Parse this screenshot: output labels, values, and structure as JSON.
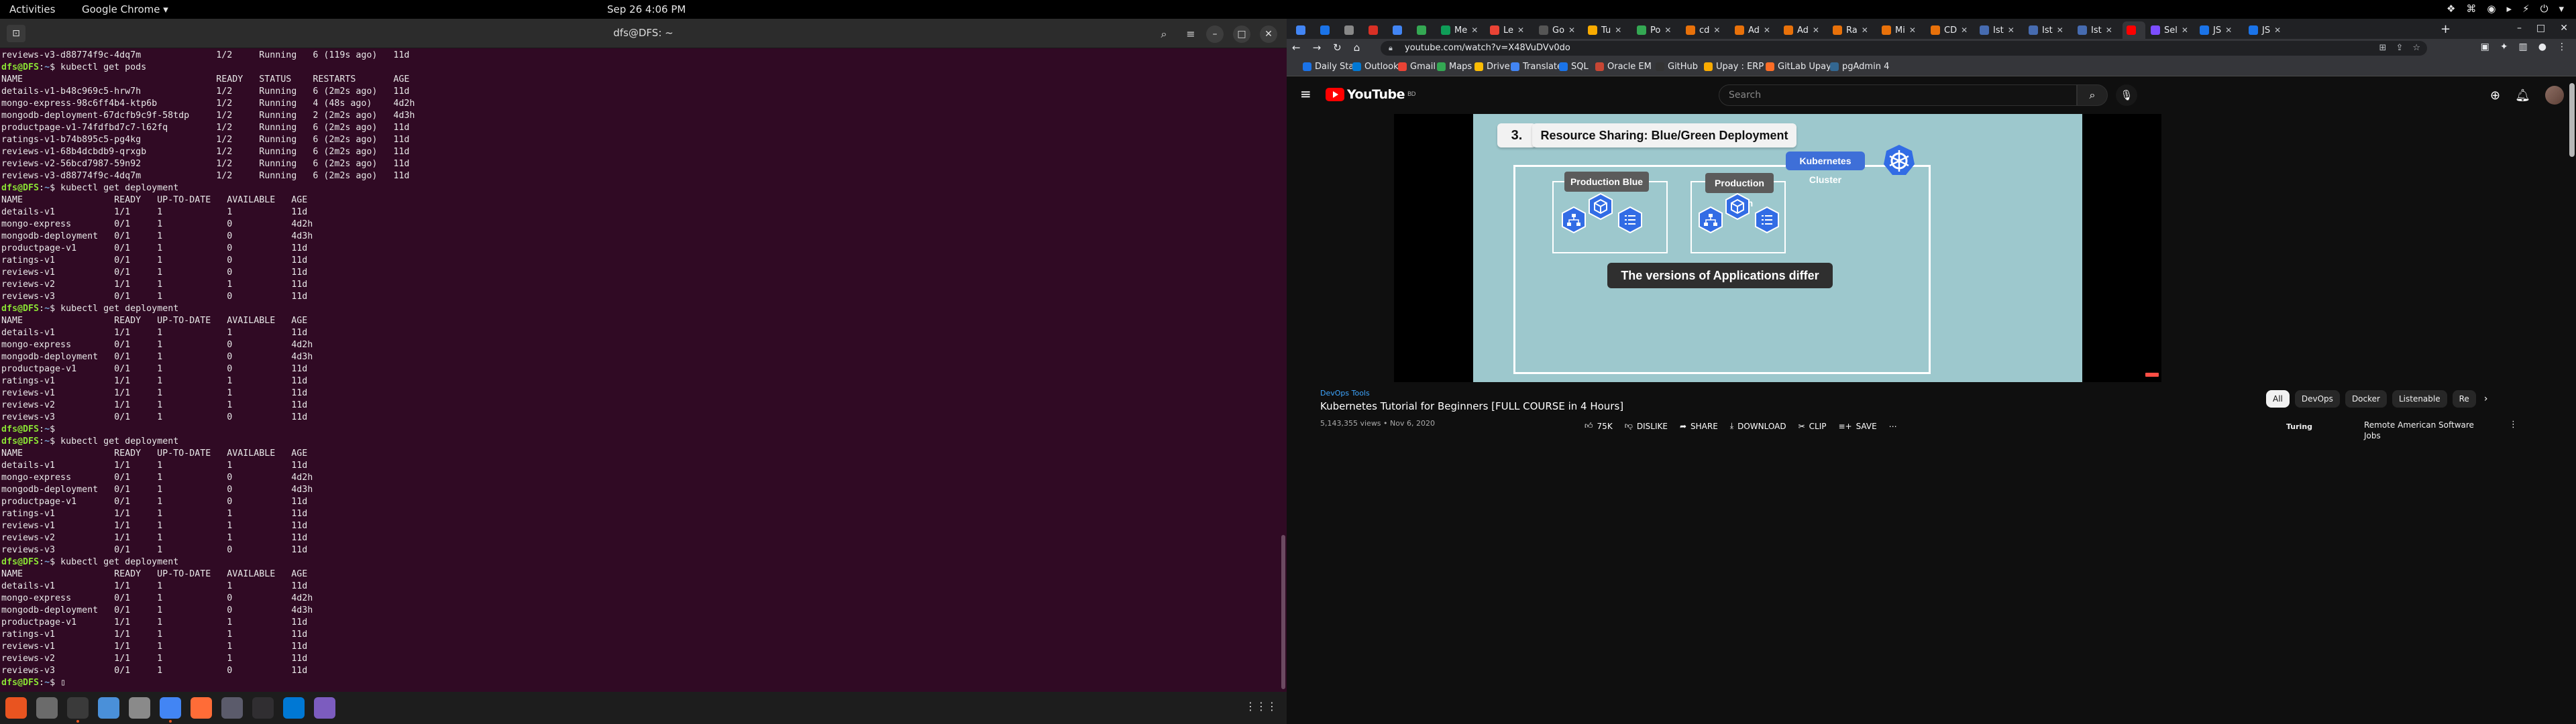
{
  "topbar": {
    "activities": "Activities",
    "app_menu": "Google Chrome ▾",
    "clock": "Sep 26  4:06 PM",
    "tray": [
      "❖",
      "⌘",
      "◉",
      "▸",
      "⚡",
      "⏻",
      "▾"
    ]
  },
  "terminal": {
    "title": "dfs@DFS: ~",
    "prompt": "dfs@DFS",
    "path": "~",
    "lines": [
      {
        "t": "out",
        "s": "reviews-v3-d88774f9c-4dq7m              1/2     Running   6 (119s ago)   11d"
      },
      {
        "t": "cmd",
        "s": "kubectl get pods"
      },
      {
        "t": "out",
        "s": "NAME                                    READY   STATUS    RESTARTS       AGE"
      },
      {
        "t": "out",
        "s": "details-v1-b48c969c5-hrw7h              1/2     Running   6 (2m2s ago)   11d"
      },
      {
        "t": "out",
        "s": "mongo-express-98c6ff4b4-ktp6b           1/2     Running   4 (48s ago)    4d2h"
      },
      {
        "t": "out",
        "s": "mongodb-deployment-67dcfb9c9f-58tdp     1/2     Running   2 (2m2s ago)   4d3h"
      },
      {
        "t": "out",
        "s": "productpage-v1-74fdfbd7c7-l62fq         1/2     Running   6 (2m2s ago)   11d"
      },
      {
        "t": "out",
        "s": "ratings-v1-b74b895c5-pg4kg              1/2     Running   6 (2m2s ago)   11d"
      },
      {
        "t": "out",
        "s": "reviews-v1-68b4dcbdb9-qrxgb             1/2     Running   6 (2m2s ago)   11d"
      },
      {
        "t": "out",
        "s": "reviews-v2-56bcd7987-59n92              1/2     Running   6 (2m2s ago)   11d"
      },
      {
        "t": "out",
        "s": "reviews-v3-d88774f9c-4dq7m              1/2     Running   6 (2m2s ago)   11d"
      },
      {
        "t": "cmd",
        "s": "kubectl get deployment"
      },
      {
        "t": "out",
        "s": "NAME                 READY   UP-TO-DATE   AVAILABLE   AGE"
      },
      {
        "t": "out",
        "s": "details-v1           1/1     1            1           11d"
      },
      {
        "t": "out",
        "s": "mongo-express        0/1     1            0           4d2h"
      },
      {
        "t": "out",
        "s": "mongodb-deployment   0/1     1            0           4d3h"
      },
      {
        "t": "out",
        "s": "productpage-v1       0/1     1            0           11d"
      },
      {
        "t": "out",
        "s": "ratings-v1           0/1     1            0           11d"
      },
      {
        "t": "out",
        "s": "reviews-v1           0/1     1            0           11d"
      },
      {
        "t": "out",
        "s": "reviews-v2           1/1     1            1           11d"
      },
      {
        "t": "out",
        "s": "reviews-v3           0/1     1            0           11d"
      },
      {
        "t": "cmd",
        "s": "kubectl get deployment"
      },
      {
        "t": "out",
        "s": "NAME                 READY   UP-TO-DATE   AVAILABLE   AGE"
      },
      {
        "t": "out",
        "s": "details-v1           1/1     1            1           11d"
      },
      {
        "t": "out",
        "s": "mongo-express        0/1     1            0           4d2h"
      },
      {
        "t": "out",
        "s": "mongodb-deployment   0/1     1            0           4d3h"
      },
      {
        "t": "out",
        "s": "productpage-v1       0/1     1            0           11d"
      },
      {
        "t": "out",
        "s": "ratings-v1           1/1     1            1           11d"
      },
      {
        "t": "out",
        "s": "reviews-v1           1/1     1            1           11d"
      },
      {
        "t": "out",
        "s": "reviews-v2           1/1     1            1           11d"
      },
      {
        "t": "out",
        "s": "reviews-v3           0/1     1            0           11d"
      },
      {
        "t": "cmd",
        "s": ""
      },
      {
        "t": "cmd",
        "s": "kubectl get deployment"
      },
      {
        "t": "out",
        "s": "NAME                 READY   UP-TO-DATE   AVAILABLE   AGE"
      },
      {
        "t": "out",
        "s": "details-v1           1/1     1            1           11d"
      },
      {
        "t": "out",
        "s": "mongo-express        0/1     1            0           4d2h"
      },
      {
        "t": "out",
        "s": "mongodb-deployment   0/1     1            0           4d3h"
      },
      {
        "t": "out",
        "s": "productpage-v1       0/1     1            0           11d"
      },
      {
        "t": "out",
        "s": "ratings-v1           1/1     1            1           11d"
      },
      {
        "t": "out",
        "s": "reviews-v1           1/1     1            1           11d"
      },
      {
        "t": "out",
        "s": "reviews-v2           1/1     1            1           11d"
      },
      {
        "t": "out",
        "s": "reviews-v3           0/1     1            0           11d"
      },
      {
        "t": "cmd",
        "s": "kubectl get deployment"
      },
      {
        "t": "out",
        "s": "NAME                 READY   UP-TO-DATE   AVAILABLE   AGE"
      },
      {
        "t": "out",
        "s": "details-v1           1/1     1            1           11d"
      },
      {
        "t": "out",
        "s": "mongo-express        0/1     1            0           4d2h"
      },
      {
        "t": "out",
        "s": "mongodb-deployment   0/1     1            0           4d3h"
      },
      {
        "t": "out",
        "s": "productpage-v1       1/1     1            1           11d"
      },
      {
        "t": "out",
        "s": "ratings-v1           1/1     1            1           11d"
      },
      {
        "t": "out",
        "s": "reviews-v1           1/1     1            1           11d"
      },
      {
        "t": "out",
        "s": "reviews-v2           1/1     1            1           11d"
      },
      {
        "t": "out",
        "s": "reviews-v3           0/1     1            0           11d"
      },
      {
        "t": "cmd",
        "s": "▯"
      }
    ]
  },
  "dock": {
    "apps": [
      {
        "name": "ubuntu-software-icon",
        "color": "#e95420"
      },
      {
        "name": "settings-icon",
        "color": "#6b6b6b"
      },
      {
        "name": "terminal-icon",
        "color": "#3a3a3a",
        "running": true
      },
      {
        "name": "text-editor-icon",
        "color": "#4a90d9"
      },
      {
        "name": "files-icon",
        "color": "#8a8a8a"
      },
      {
        "name": "chrome-icon",
        "color": "#4285f4",
        "running": true
      },
      {
        "name": "postman-icon",
        "color": "#ff6c37"
      },
      {
        "name": "screenshot-icon",
        "color": "#5b5b6b"
      },
      {
        "name": "obs-icon",
        "color": "#302e31"
      },
      {
        "name": "vscode-icon",
        "color": "#0078d4"
      },
      {
        "name": "dbeaver-icon",
        "color": "#7c5cbf"
      }
    ],
    "grid": "⋮⋮⋮"
  },
  "chrome": {
    "tabs": [
      {
        "label": "",
        "color": "#4285f4"
      },
      {
        "label": "",
        "color": "#1a73e8"
      },
      {
        "label": "",
        "color": "#888"
      },
      {
        "label": "",
        "color": "#d93025"
      },
      {
        "label": "",
        "color": "#4285f4"
      },
      {
        "label": "",
        "color": "#34a853"
      },
      {
        "label": "Me",
        "color": "#0f9d58"
      },
      {
        "label": "Le",
        "color": "#ea4335"
      },
      {
        "label": "Go",
        "color": "#555"
      },
      {
        "label": "Tu",
        "color": "#f9ab00"
      },
      {
        "label": "Po",
        "color": "#34a853"
      },
      {
        "label": "cd",
        "color": "#e8710a"
      },
      {
        "label": "Ad",
        "color": "#e8710a"
      },
      {
        "label": "Ad",
        "color": "#e8710a"
      },
      {
        "label": "Ra",
        "color": "#e8710a"
      },
      {
        "label": "Mi",
        "color": "#e8710a"
      },
      {
        "label": "CD",
        "color": "#e8710a"
      },
      {
        "label": "Ist",
        "color": "#466bb0"
      },
      {
        "label": "Ist",
        "color": "#466bb0"
      },
      {
        "label": "Ist",
        "color": "#466bb0"
      },
      {
        "label": "",
        "color": "#ff0000",
        "active": true
      },
      {
        "label": "Sel",
        "color": "#7c4dff"
      },
      {
        "label": "JS",
        "color": "#1a73e8"
      },
      {
        "label": "JS",
        "color": "#1a73e8"
      }
    ],
    "window_controls": [
      "–",
      "□",
      "✕"
    ],
    "url": "youtube.com/watch?v=X48VuDVv0do",
    "bookmarks": [
      {
        "label": "Daily Star",
        "color": "#1a73e8"
      },
      {
        "label": "Outlook",
        "color": "#0078d4"
      },
      {
        "label": "Gmail",
        "color": "#ea4335"
      },
      {
        "label": "Maps",
        "color": "#34a853"
      },
      {
        "label": "Drive",
        "color": "#fbbc04"
      },
      {
        "label": "Translate",
        "color": "#4285f4"
      },
      {
        "label": "SQL",
        "color": "#1a73e8"
      },
      {
        "label": "Oracle EM",
        "color": "#c74634"
      },
      {
        "label": "GitHub",
        "color": "#333"
      },
      {
        "label": "Upay : ERP",
        "color": "#f9ab00"
      },
      {
        "label": "GitLab Upay",
        "color": "#fc6d26"
      },
      {
        "label": "pgAdmin 4",
        "color": "#336791"
      }
    ]
  },
  "youtube": {
    "logo": "YouTube",
    "country": "BD",
    "search_placeholder": "Search",
    "slide": {
      "number": "3.",
      "title": "Resource Sharing: Blue/Green Deployment",
      "cluster_label": "Kubernetes Cluster",
      "blue_label": "Production Blue",
      "green_label": "Production Green",
      "caption": "The versions of Applications differ"
    },
    "channel": "DevOps Tools",
    "video_title": "Kubernetes Tutorial for Beginners [FULL COURSE in 4 Hours]",
    "meta": "5,143,355 views • Nov 6, 2020",
    "actions": {
      "likes": "75K",
      "dislike": "DISLIKE",
      "share": "SHARE",
      "download": "DOWNLOAD",
      "clip": "CLIP",
      "save": "SAVE",
      "more": "⋯"
    },
    "chips": [
      "All",
      "DevOps",
      "Docker",
      "Listenable",
      "Re"
    ],
    "recommendation": {
      "channel": "Turing",
      "title": "Remote American Software Jobs"
    }
  }
}
